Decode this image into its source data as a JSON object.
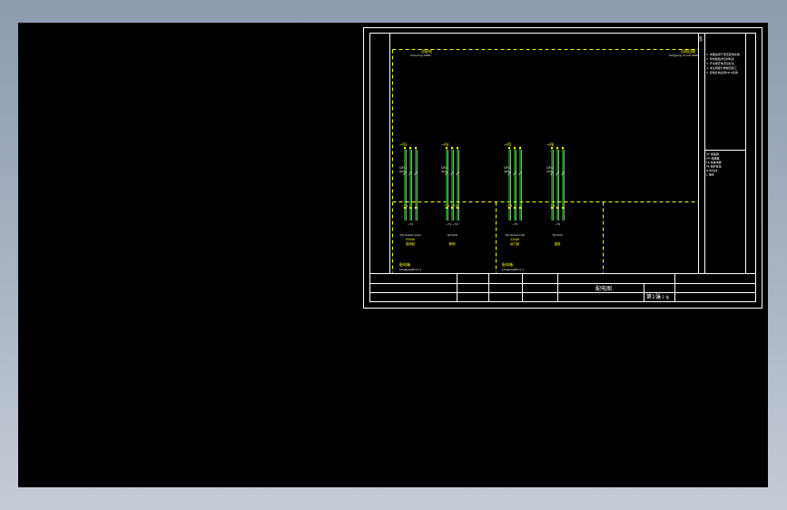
{
  "drawing": {
    "title_block": {
      "drawing_name": "配电图",
      "sheet_label": "第1张",
      "sheet_of": "共 1 张"
    },
    "area_labels": {
      "left_top": "总配电",
      "left_top_sub": "Incoming 400V",
      "right_top": "出线回路",
      "right_top_sub": "Outgoing circuit 400V",
      "bottom_left": "配电箱",
      "bottom_left_sub": "Longlength=x-1",
      "bottom_mid": "配电箱",
      "bottom_mid_sub": "Longlength=x-1"
    },
    "circuits": [
      {
        "top_tag": "~P3",
        "device_code": "QF1",
        "device_rating": "63A",
        "bottom_tag": "~T1",
        "cable": "YJV-4x16+1x10",
        "label1": "55kW",
        "label2": "进线柜"
      },
      {
        "top_tag": "~P4",
        "device_code": "QF2",
        "device_rating": "32A",
        "bottom_tag": "~T1 ~T2",
        "cable": "YJV-5x6",
        "label1": "",
        "label2": "照明"
      },
      {
        "top_tag": "~P5",
        "device_code": "QF3",
        "device_rating": "40A",
        "bottom_tag": "~T3",
        "cable": "YJV-4x10+1x6",
        "label1": "22kW",
        "label2": "动力柜"
      },
      {
        "top_tag": "~P6",
        "device_code": "QF4",
        "device_rating": "25A",
        "bottom_tag": "~T4",
        "cable": "YJV-5x4",
        "label1": "",
        "label2": "插座"
      }
    ],
    "notes": {
      "header": "说明",
      "items": [
        "1. 本图适用于低压配电系统",
        "2. 导线规格详见材料表",
        "3. 开关额定电流见标注",
        "4. 未注明部分按规范施工",
        "5. 接地系统采用TN-S系统"
      ],
      "legend": [
        "QF 断路器",
        "KM 接触器",
        "FR 热继电器",
        "PE 保护接地",
        "N 中性线",
        "L 相线"
      ]
    }
  }
}
